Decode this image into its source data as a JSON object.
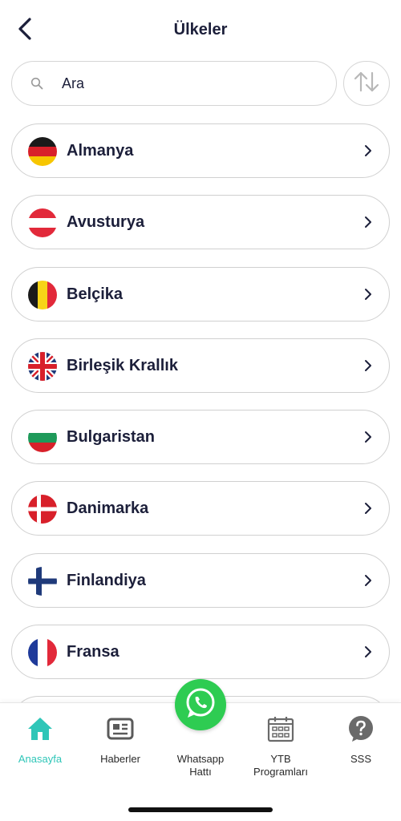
{
  "header": {
    "title": "Ülkeler",
    "back_icon": "chevron-left-icon"
  },
  "search": {
    "value": "",
    "placeholder": "Ara",
    "icon": "search-icon",
    "sort_icon": "sort-arrows-icon"
  },
  "countries": [
    {
      "name": "Almanya",
      "flag": "germany-flag-icon"
    },
    {
      "name": "Avusturya",
      "flag": "austria-flag-icon"
    },
    {
      "name": "Belçika",
      "flag": "belgium-flag-icon"
    },
    {
      "name": "Birleşik Krallık",
      "flag": "uk-flag-icon"
    },
    {
      "name": "Bulgaristan",
      "flag": "bulgaria-flag-icon"
    },
    {
      "name": "Danimarka",
      "flag": "denmark-flag-icon"
    },
    {
      "name": "Finlandiya",
      "flag": "finland-flag-icon"
    },
    {
      "name": "Fransa",
      "flag": "france-flag-icon"
    }
  ],
  "nav": {
    "home_label": "Anasayfa",
    "news_label": "Haberler",
    "whatsapp_label": "Whatsapp\nHattı",
    "programs_label": "YTB\nProgramları",
    "faq_label": "SSS"
  },
  "colors": {
    "accent": "#2fc6b8",
    "whatsapp": "#2ecc52",
    "text": "#1c1f3a",
    "border": "#d0d0d0"
  }
}
